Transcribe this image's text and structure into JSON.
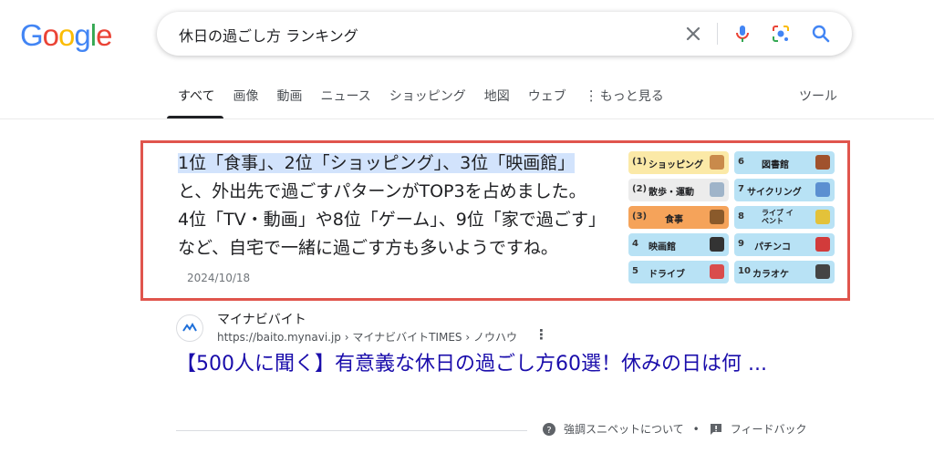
{
  "logo": {
    "letters": [
      "G",
      "o",
      "o",
      "g",
      "l",
      "e"
    ],
    "colors": [
      "#4285F4",
      "#EA4335",
      "#FBBC05",
      "#4285F4",
      "#34A853",
      "#EA4335"
    ]
  },
  "search": {
    "query": "休日の過ごし方 ランキング"
  },
  "icons": {
    "clear": "close-icon",
    "voice": "mic-icon",
    "lens": "lens-icon",
    "search": "search-icon"
  },
  "tabs": [
    {
      "label": "すべて",
      "active": true
    },
    {
      "label": "画像"
    },
    {
      "label": "動画"
    },
    {
      "label": "ニュース"
    },
    {
      "label": "ショッピング"
    },
    {
      "label": "地図"
    },
    {
      "label": "ウェブ"
    },
    {
      "label": "もっと見る"
    }
  ],
  "tools_label": "ツール",
  "snippet": {
    "highlight": "1位「食事」、2位「ショッピング」、3位「映画館」",
    "text": "と、外出先で過ごすパターンがTOP3を占めました。 4位「TV・動画」や8位「ゲーム」、9位「家で過ごす」など、自宅で一緒に過ごす方も多いようですね。",
    "date": "2024/10/18",
    "ranking_left": [
      {
        "num": "(1)",
        "label": "ショッピング",
        "color": "#fbe9a7"
      },
      {
        "num": "(2)",
        "label": "散歩・運動",
        "color": "#ececec"
      },
      {
        "num": "(3)",
        "label": "食事",
        "color": "#f5a35a"
      },
      {
        "num": "4",
        "label": "映画館",
        "color": "#b8e2f5"
      },
      {
        "num": "5",
        "label": "ドライブ",
        "color": "#b8e2f5"
      }
    ],
    "ranking_right": [
      {
        "num": "6",
        "label": "図書館",
        "color": "#b8e2f5"
      },
      {
        "num": "7",
        "label": "サイクリング",
        "color": "#b8e2f5"
      },
      {
        "num": "8",
        "label": "ライブ イベント",
        "color": "#b8e2f5"
      },
      {
        "num": "9",
        "label": "パチンコ",
        "color": "#b8e2f5"
      },
      {
        "num": "10",
        "label": "カラオケ",
        "color": "#b8e2f5"
      }
    ]
  },
  "source": {
    "name": "マイナビバイト",
    "url": "https://baito.mynavi.jp › マイナビバイトTIMES › ノウハウ",
    "title": "【500人に聞く】有意義な休日の過ごし方60選！休みの日は何 ..."
  },
  "footer": {
    "about": "強調スニペットについて",
    "separator": "•",
    "feedback": "フィードバック"
  }
}
